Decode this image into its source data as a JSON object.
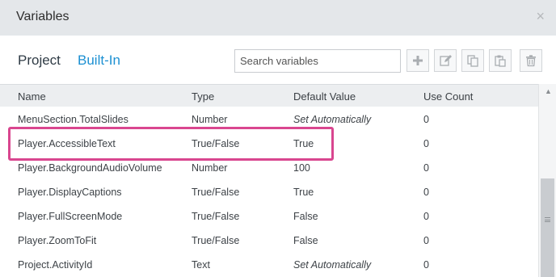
{
  "window": {
    "title": "Variables",
    "close_glyph": "×"
  },
  "tabs": [
    {
      "label": "Project",
      "active": false
    },
    {
      "label": "Built-In",
      "active": true
    }
  ],
  "search": {
    "placeholder": "Search variables",
    "value": ""
  },
  "toolbar_icons": [
    "add-icon",
    "edit-icon",
    "copy-icon",
    "paste-icon",
    "delete-icon"
  ],
  "table": {
    "headers": [
      "Name",
      "Type",
      "Default Value",
      "Use Count"
    ],
    "rows": [
      {
        "name": "MenuSection.TotalSlides",
        "type": "Number",
        "default": "Set Automatically",
        "use_count": "0"
      },
      {
        "name": "Player.AccessibleText",
        "type": "True/False",
        "default": "True",
        "use_count": "0"
      },
      {
        "name": "Player.BackgroundAudioVolume",
        "type": "Number",
        "default": "100",
        "use_count": "0"
      },
      {
        "name": "Player.DisplayCaptions",
        "type": "True/False",
        "default": "True",
        "use_count": "0"
      },
      {
        "name": "Player.FullScreenMode",
        "type": "True/False",
        "default": "False",
        "use_count": "0"
      },
      {
        "name": "Player.ZoomToFit",
        "type": "True/False",
        "default": "False",
        "use_count": "0"
      },
      {
        "name": "Project.ActivityId",
        "type": "Text",
        "default": "Set Automatically",
        "use_count": "0"
      }
    ]
  },
  "colors": {
    "highlight": "#d9468f",
    "active_tab": "#1c90d2",
    "titlebar": "#e4e7ea"
  }
}
